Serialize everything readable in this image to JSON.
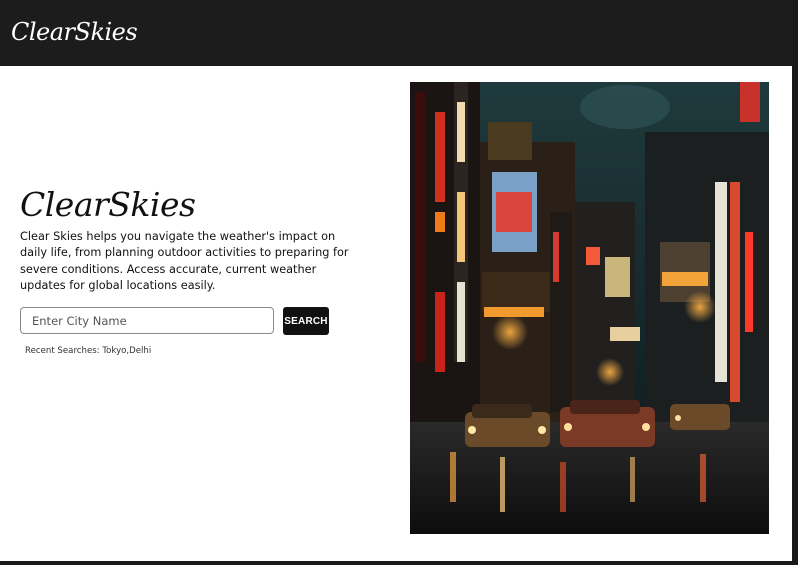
{
  "navbar": {
    "brand": "ClearSkies"
  },
  "hero": {
    "title": "ClearSkies",
    "description": "Clear Skies helps you navigate the weather's impact on daily life, from planning outdoor activities to preparing for severe conditions. Access accurate, current weather updates for global locations easily."
  },
  "search": {
    "placeholder": "Enter City Name",
    "value": "",
    "button_label": "SEARCH"
  },
  "recent": {
    "label": "Recent Searches: Tokyo,Delhi"
  },
  "image": {
    "subject": "neon-lit night city street with taxis"
  },
  "colors": {
    "navbar_bg": "#1c1c1c",
    "page_bg": "#ffffff",
    "button_bg": "#111111",
    "text": "#111111"
  }
}
